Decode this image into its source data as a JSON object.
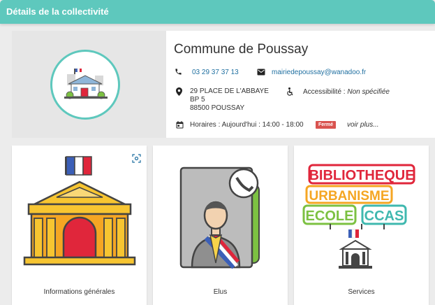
{
  "header": {
    "title": "Détails de la collectivité"
  },
  "commune": {
    "name": "Commune de Poussay",
    "phone": "03 29 37 37 13",
    "email": "mairiedepoussay@wanadoo.fr",
    "address_line1": "29 PLACE DE L'ABBAYE",
    "address_line2": "BP 5",
    "address_line3": "88500 POUSSAY",
    "accessibility_label": "Accessibilité : ",
    "accessibility_value": "Non spécifiée",
    "hours_text": "Horaires : Aujourd'hui : 14:00 - 18:00",
    "status_badge": "Fermé",
    "see_more": "voir plus..."
  },
  "tiles": [
    {
      "label": "Informations générales",
      "icon": "town-hall-icon"
    },
    {
      "label": "Elus",
      "icon": "elected-official-icon"
    },
    {
      "label": "Services",
      "icon": "services-icon"
    }
  ],
  "services_words": {
    "w1": "BIBLIOTHEQUE",
    "w2": "URBANISME",
    "w3": "ECOLE",
    "w4": "CCAS"
  },
  "colors": {
    "accent": "#5ec8bd",
    "link": "#1f6fa0",
    "closed_badge": "#d9534f",
    "word_red": "#e0263b",
    "word_orange": "#f5a623",
    "word_green": "#7cc142",
    "word_teal": "#3fb8af"
  }
}
